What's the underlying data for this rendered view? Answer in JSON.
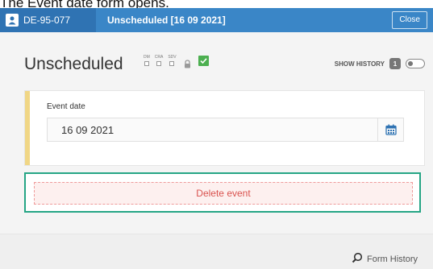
{
  "caption": "The Event date form opens.",
  "topbar": {
    "subject_id": "DE-95-077",
    "tab_title": "Unscheduled [16 09 2021]",
    "close_label": "Close"
  },
  "header": {
    "title": "Unscheduled",
    "flags": [
      "DM",
      "CRA",
      "SDV"
    ],
    "show_history_label": "SHOW HISTORY",
    "history_count": "1"
  },
  "card": {
    "label": "Event date",
    "value": "16 09 2021"
  },
  "delete_label": "Delete event",
  "footer": {
    "form_history_label": "Form History"
  },
  "colors": {
    "topbar": "#3a86c7",
    "subject_bg": "#2f73b3",
    "accent_yellow": "#f0d685",
    "highlight_green": "#25a585",
    "delete_red": "#d9534f",
    "check_green": "#4caf50"
  },
  "icons": [
    "user-avatar-icon",
    "lock-icon",
    "checkmark-icon",
    "calendar-icon",
    "search-icon"
  ]
}
